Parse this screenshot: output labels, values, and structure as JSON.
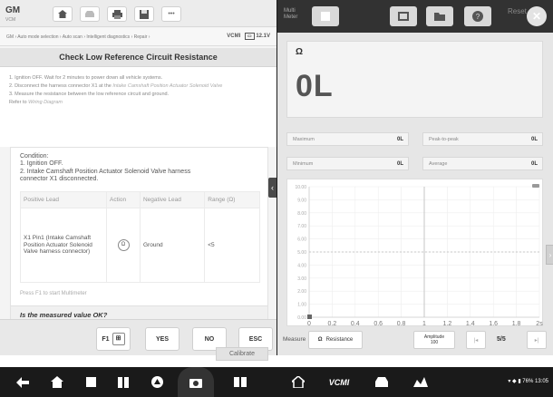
{
  "left_panel": {
    "brand": "GM",
    "brand_sub": "VCM",
    "toolbar_icons": [
      "home-icon",
      "car-icon",
      "print-icon",
      "save-icon",
      "more-icon"
    ],
    "more_label": "•••",
    "breadcrumb": "GM › Auto mode selection › Auto scan › Intelligent diagnostics › Repair ›",
    "vcm_label": "VCMI",
    "voltage": "12.1V",
    "title": "Check Low Reference Circuit Resistance",
    "steps": [
      "1. Ignition OFF. Wait for 2 minutes to power down all vehicle systems.",
      "2. Disconnect the harness connector X1 at the",
      "Intake Camshaft Position Actuator Solenoid Valve",
      "3. Measure the resistance between the low reference circuit and ground.",
      "Refer to",
      "Wiring Diagram"
    ],
    "condition_lines": [
      "Condition:",
      "1. Ignition OFF.",
      "2. Intake Camshaft Position Actuator Solenoid Valve harness",
      "connector X1 disconnected."
    ],
    "table": {
      "headers": [
        "Positive Lead",
        "Action",
        "Negative Lead",
        "Range (Ω)"
      ],
      "row": [
        "X1 Pin1 (Intake Camshaft Position Actuator Solenoid Valve harness connector)",
        "Ω",
        "Ground",
        "<5"
      ]
    },
    "press_text": "Press F1 to start Multimeter",
    "question": "Is the measured value OK?",
    "buttons": {
      "f1": "F1",
      "yes": "YES",
      "no": "NO",
      "esc": "ESC"
    }
  },
  "right_panel": {
    "logo": "Multi Meter",
    "tool_icons": [
      "square-icon",
      "display-icon",
      "folder-icon",
      "help-icon"
    ],
    "reset": "Reset",
    "unit": "Ω",
    "reading": "0L",
    "stats": {
      "maximum": {
        "label": "Maximum",
        "value": "0L"
      },
      "minimum": {
        "label": "Minimum",
        "value": "0L"
      },
      "peak": {
        "label": "Peak-to-peak",
        "value": "0L"
      },
      "average": {
        "label": "Average",
        "value": "0L"
      }
    },
    "measure_label": "Measure",
    "mode": "Resistance",
    "amplitude_label": "Amplitude",
    "amplitude_value": "100",
    "page": "5/5",
    "calibrate": "Calibrate"
  },
  "chart_data": {
    "type": "line",
    "x_ticks": [
      "0",
      "0.2",
      "0.4",
      "0.6",
      "0.8",
      "1",
      "1.2",
      "1.4",
      "1.6",
      "1.8",
      "2s"
    ],
    "y_ticks": [
      "10.00",
      "9.00",
      "8.00",
      "7.00",
      "6.00",
      "5.00",
      "4.00",
      "3.00",
      "2.00",
      "1.00",
      "0.00"
    ],
    "ylim": [
      0,
      10
    ],
    "xlim": [
      0,
      2
    ],
    "grid": true
  },
  "system_bar": {
    "icons": [
      "back-icon",
      "home-icon",
      "stop-icon",
      "apps-icon",
      "browser-icon",
      "camera-icon",
      "split-icon",
      "home2-icon",
      "vcm-icon",
      "car-icon",
      "network-icon"
    ],
    "vcm_text": "VCMI",
    "clock": "▾ ◆ ▮ 76% 13:05"
  }
}
